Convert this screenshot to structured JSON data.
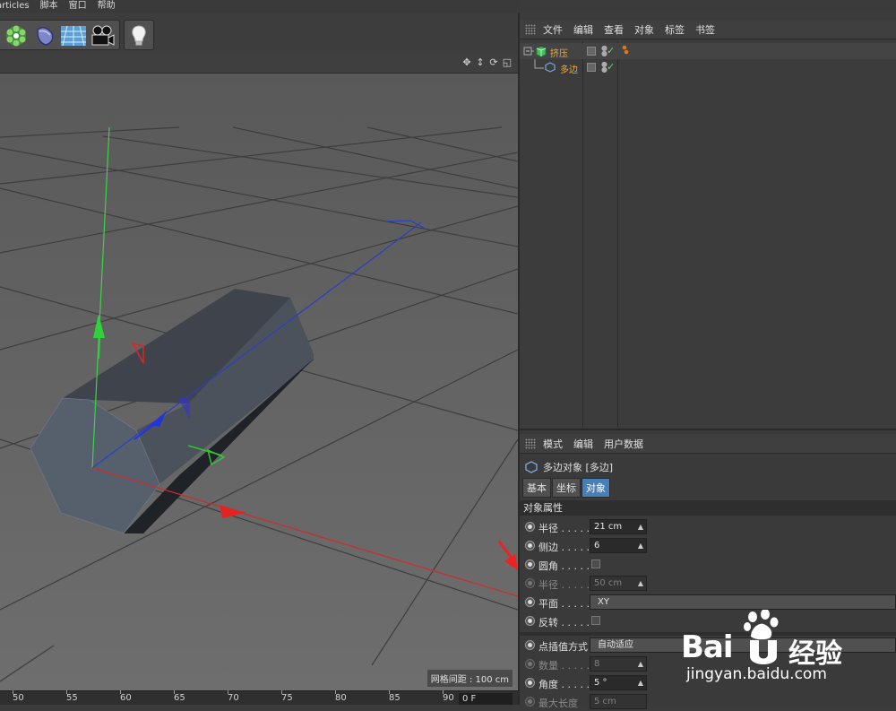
{
  "menubar": {
    "items": [
      "articles",
      "脚本",
      "窗口",
      "帮助"
    ]
  },
  "toolbar": {
    "icons": [
      "mograph-cloner-icon",
      "deformer-icon",
      "scene-floor-icon",
      "camera-icon",
      "light-bulb-icon"
    ]
  },
  "viewport": {
    "grid_label": "网格间距 : 100 cm"
  },
  "timeline": {
    "ticks": [
      "50",
      "55",
      "60",
      "65",
      "70",
      "75",
      "80",
      "85",
      "90"
    ],
    "frame_field": "0 F"
  },
  "object_manager": {
    "menu": [
      "文件",
      "编辑",
      "查看",
      "对象",
      "标签",
      "书签"
    ],
    "objects": [
      {
        "name": "挤压",
        "level": 0
      },
      {
        "name": "多边",
        "level": 1
      }
    ]
  },
  "attribute_manager": {
    "menu": [
      "模式",
      "编辑",
      "用户数据"
    ],
    "title": "多边对象 [多边]",
    "tabs": [
      "基本",
      "坐标",
      "对象"
    ],
    "active_tab": "对象",
    "section": "对象属性",
    "params": [
      {
        "label": "半径 . . . . .",
        "value": "21 cm",
        "type": "spinner",
        "enabled": true
      },
      {
        "label": "侧边 . . . . .",
        "value": "6",
        "type": "spinner",
        "enabled": true
      },
      {
        "label": "圆角 . . . . .",
        "value": "",
        "type": "checkbox",
        "enabled": true
      },
      {
        "label": "半径 . . . . .",
        "value": "50 cm",
        "type": "spinner",
        "enabled": false
      },
      {
        "label": "平面 . . . . .",
        "value": "XY",
        "type": "dropdown",
        "enabled": true
      },
      {
        "label": "反转 . . . . .",
        "value": "",
        "type": "checkbox",
        "enabled": true
      }
    ],
    "params2": [
      {
        "label": "点插值方式",
        "value": "自动适应",
        "type": "dropdown",
        "enabled": true
      },
      {
        "label": "数量 . . . . .",
        "value": "8",
        "type": "spinner",
        "enabled": false
      },
      {
        "label": "角度 . . . . .",
        "value": "5 °",
        "type": "spinner",
        "enabled": true
      },
      {
        "label": "最大长度",
        "value": "5 cm",
        "type": "spinner",
        "enabled": false
      }
    ]
  },
  "watermark": {
    "brand": "Bai",
    "brand_cn": "经验",
    "url": "jingyan.baidu.com"
  }
}
